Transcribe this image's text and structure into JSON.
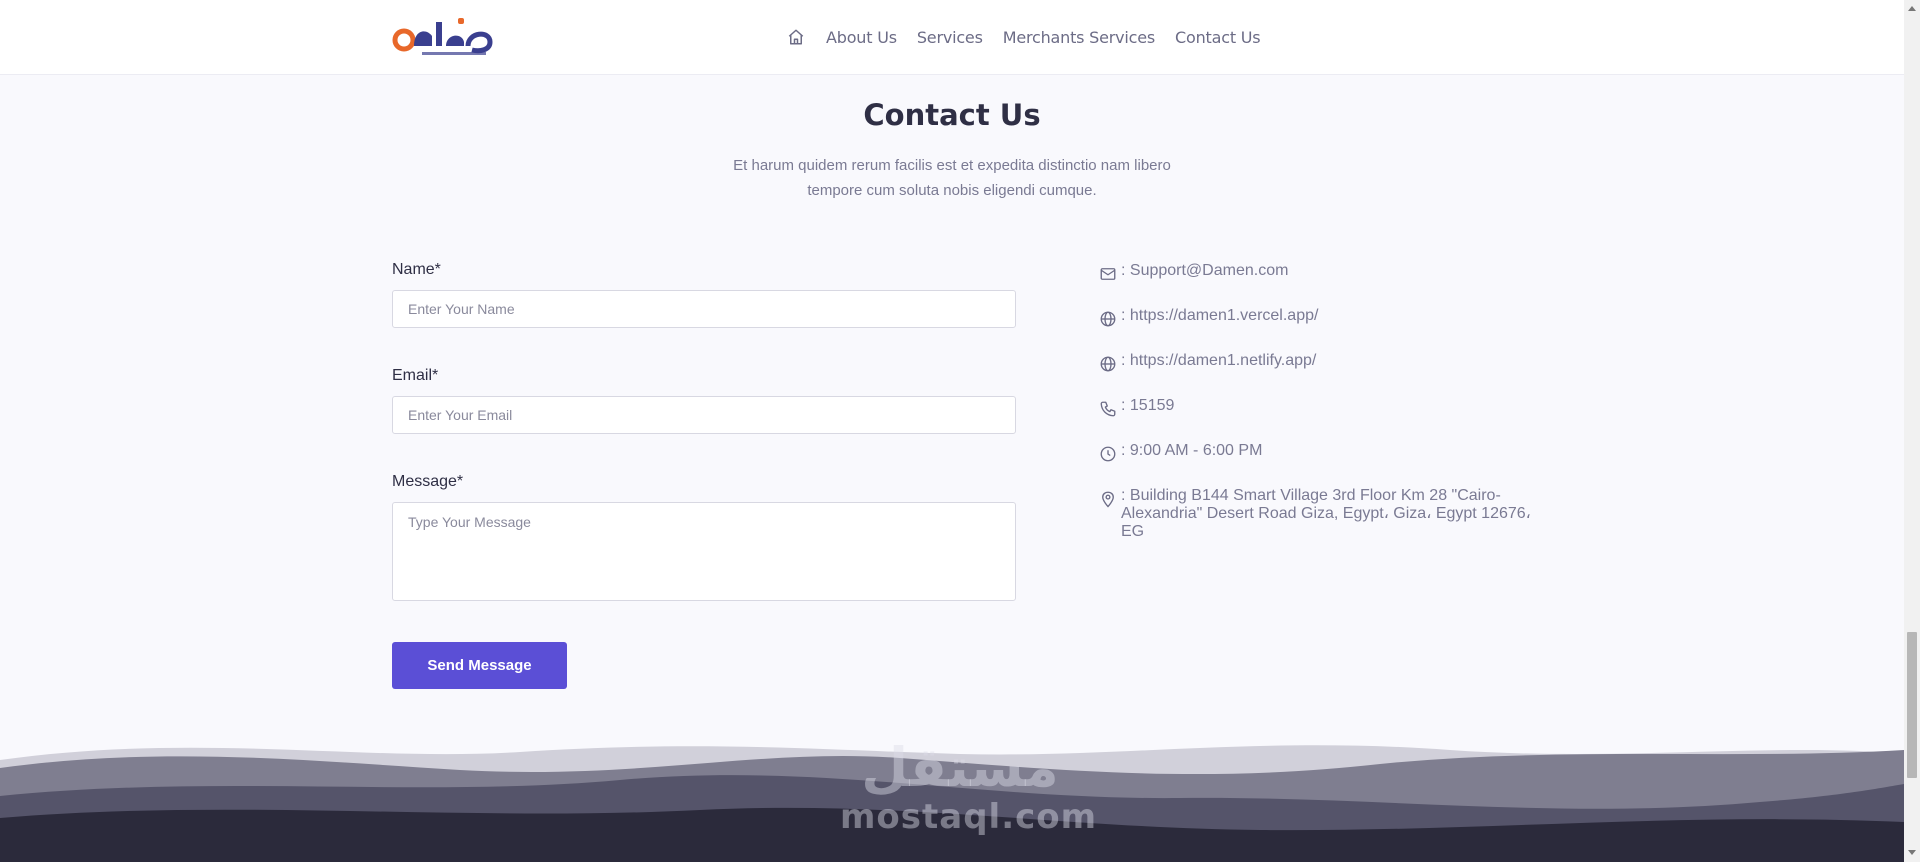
{
  "header": {
    "nav": [
      {
        "label": "About Us"
      },
      {
        "label": "Services"
      },
      {
        "label": "Merchants Services"
      },
      {
        "label": "Contact Us"
      }
    ]
  },
  "section": {
    "title": "Contact Us",
    "subtitle_line1": "Et harum quidem rerum facilis est et expedita distinctio nam libero",
    "subtitle_line2": "tempore cum soluta nobis eligendi cumque."
  },
  "form": {
    "name_label": "Name*",
    "name_placeholder": "Enter Your Name",
    "email_label": "Email*",
    "email_placeholder": "Enter Your Email",
    "message_label": "Message*",
    "message_placeholder": "Type Your Message",
    "submit_label": "Send Message"
  },
  "contact_info": {
    "email": ": Support@Damen.com",
    "website1": ": https://damen1.vercel.app/",
    "website2": ": https://damen1.netlify.app/",
    "phone": ": 15159",
    "hours": ": 9:00 AM - 6:00 PM",
    "address": ": Building B144 Smart Village 3rd Floor Km 28 \"Cairo-Alexandria\" Desert Road Giza, Egypt، Giza، Egypt 12676، EG"
  },
  "watermark": {
    "arabic": "مستقل",
    "latin": "mostaql.com"
  },
  "colors": {
    "accent": "#5b4fd6",
    "logo_orange": "#e8682a",
    "logo_navy": "#3a3f8f",
    "footer_dark": "#2b2a3b"
  }
}
